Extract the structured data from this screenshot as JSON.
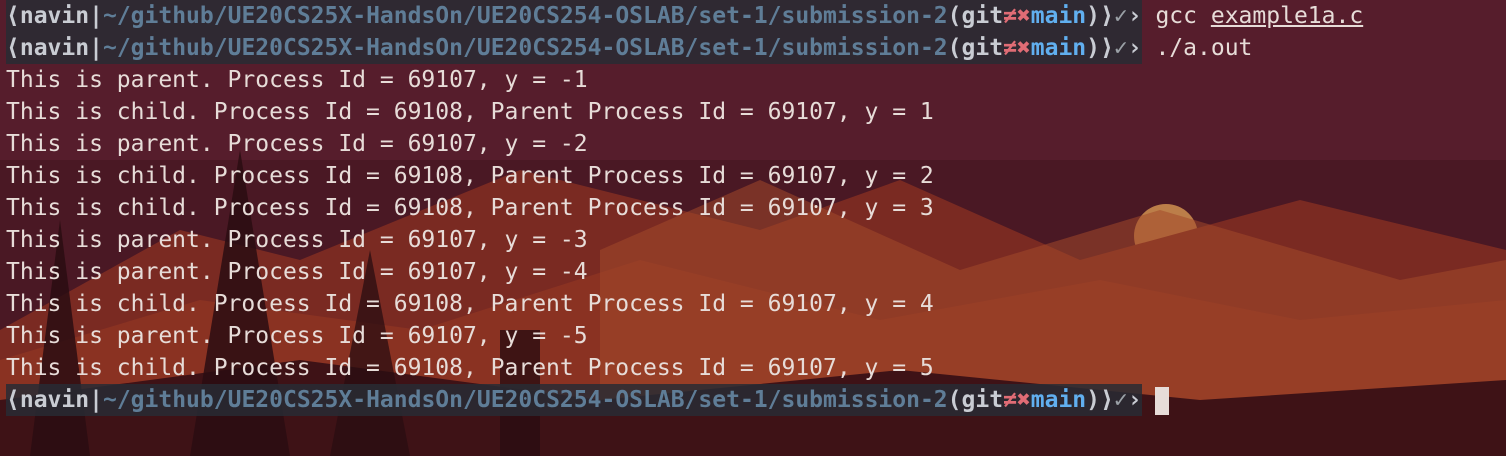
{
  "prompt": {
    "open": "⟨",
    "user": "navin",
    "sep": "|",
    "path": "~/github/UE20CS25X-HandsOn/UE20CS254-OSLAB/set-1/submission-2",
    "git_open": "(",
    "git_label": "git",
    "git_dirty": "≠✖",
    "branch": "main",
    "git_close": ")",
    "close": "⟩",
    "status": "✓",
    "arrow": "›"
  },
  "commands": [
    {
      "cmd": "gcc",
      "arg": "example1a.c"
    },
    {
      "cmd": "./a.out",
      "arg": ""
    }
  ],
  "output": [
    "This is parent. Process Id = 69107, y = -1",
    "This is child. Process Id = 69108, Parent Process Id = 69107, y = 1",
    "This is parent. Process Id = 69107, y = -2",
    "This is child. Process Id = 69108, Parent Process Id = 69107, y = 2",
    "This is child. Process Id = 69108, Parent Process Id = 69107, y = 3",
    "This is parent. Process Id = 69107, y = -3",
    "This is parent. Process Id = 69107, y = -4",
    "This is child. Process Id = 69108, Parent Process Id = 69107, y = 4",
    "This is parent. Process Id = 69107, y = -5",
    "This is child. Process Id = 69108, Parent Process Id = 69107, y = 5"
  ]
}
